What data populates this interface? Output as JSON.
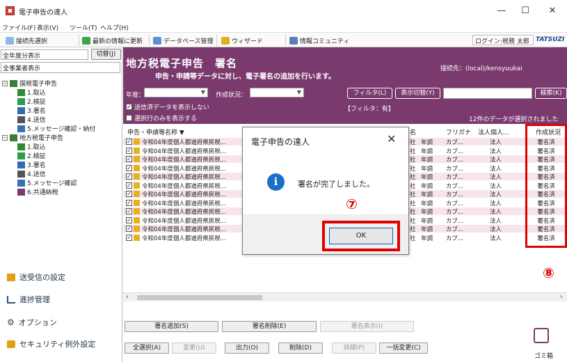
{
  "window": {
    "title": "電子申告の達人",
    "controls": {
      "minimize": "—",
      "maximize": "☐",
      "close": "✕"
    }
  },
  "menu": [
    "ファイル(F)",
    "表示(V)",
    "ツール(T)",
    "ヘルプ(H)"
  ],
  "toolbar": {
    "connection_select": "接続先選択",
    "update_latest": "最新の情報に更新",
    "db_manage": "データベース管理",
    "wizard": "ウィザード",
    "community": "情報コミュニティ",
    "login": "ログイン:税務 太郎",
    "brand": "TATSUZI"
  },
  "left": {
    "year_display": "全年度分表示",
    "switch_button": "切替(J)",
    "business_display": "全事業者表示",
    "tree": [
      {
        "label": "国税電子申告",
        "level": 0,
        "icon": "folder-icon",
        "color": "#3a7d3a"
      },
      {
        "label": "1.取込",
        "level": 1,
        "icon": "import-icon",
        "color": "#2d8a2d"
      },
      {
        "label": "2.検証",
        "level": 1,
        "icon": "check-icon",
        "color": "#2aa04a"
      },
      {
        "label": "3.署名",
        "level": 1,
        "icon": "sign-icon",
        "color": "#2f6cb0"
      },
      {
        "label": "4.送信",
        "level": 1,
        "icon": "send-icon",
        "color": "#555555"
      },
      {
        "label": "5.メッセージ確認・納付",
        "level": 1,
        "icon": "mail-icon",
        "color": "#3b6fb3"
      },
      {
        "label": "地方税電子申告",
        "level": 0,
        "icon": "folder-icon",
        "color": "#3a7d3a"
      },
      {
        "label": "1.取込",
        "level": 1,
        "icon": "import-icon",
        "color": "#2d8a2d"
      },
      {
        "label": "2.検証",
        "level": 1,
        "icon": "check-icon",
        "color": "#2aa04a"
      },
      {
        "label": "3.署名",
        "level": 1,
        "icon": "sign-icon",
        "color": "#2f6cb0"
      },
      {
        "label": "4.送信",
        "level": 1,
        "icon": "send-icon",
        "color": "#555555"
      },
      {
        "label": "5.メッセージ確認",
        "level": 1,
        "icon": "mail-icon",
        "color": "#3b6fb3"
      },
      {
        "label": "6.共通納税",
        "level": 1,
        "icon": "tax-icon",
        "color": "#7b3a6e"
      }
    ],
    "nav": [
      {
        "label": "送受信の設定",
        "icon": "transmit-settings-icon",
        "color": "#e0a010"
      },
      {
        "label": "進捗管理",
        "icon": "progress-icon",
        "color": "#2f4f7f"
      },
      {
        "label": "オプション",
        "icon": "gear-icon",
        "color": "#444444"
      },
      {
        "label": "セキュリティ例外設定",
        "icon": "lock-icon",
        "color": "#e0a010"
      }
    ]
  },
  "header": {
    "title": "地方税電子申告　署名",
    "subtitle": "申告・申請等データに対し、電子署名の追加を行います。",
    "connection": "接続先：(local)/kensyuukai",
    "year_label": "年度：",
    "status_label": "作成状況：",
    "filter_button": "フィルタ(L)",
    "display_switch_button": "表示切替(Y)",
    "search_button": "検索(K)",
    "hide_sent_label": "送信済データを表示しない",
    "show_selected_label": "選択行のみを表示する",
    "filter_status": "【フィルタ：有】",
    "selected_count": "12件のデータが選択されました"
  },
  "table": {
    "columns": [
      "申告・申請等名称 ▼",
      "名",
      "フリガナ",
      "法人個人...",
      "作成状況"
    ],
    "rows": [
      {
        "name": "令和04年度個人都道府県民税...",
        "col2": "社",
        "col3": "年調",
        "furigana": "カブ...",
        "type": "法人",
        "status": "署名済"
      },
      {
        "name": "令和04年度個人都道府県民税...",
        "col2": "社",
        "col3": "年調",
        "furigana": "カブ...",
        "type": "法人",
        "status": "署名済"
      },
      {
        "name": "令和04年度個人都道府県民税...",
        "col2": "社",
        "col3": "年調",
        "furigana": "カブ...",
        "type": "法人",
        "status": "署名済"
      },
      {
        "name": "令和04年度個人都道府県民税...",
        "col2": "社",
        "col3": "年調",
        "furigana": "カブ...",
        "type": "法人",
        "status": "署名済"
      },
      {
        "name": "令和04年度個人都道府県民税...",
        "col2": "社",
        "col3": "年調",
        "furigana": "カブ...",
        "type": "法人",
        "status": "署名済"
      },
      {
        "name": "令和04年度個人都道府県民税...",
        "col2": "社",
        "col3": "年調",
        "furigana": "カブ...",
        "type": "法人",
        "status": "署名済"
      },
      {
        "name": "令和04年度個人都道府県民税...",
        "col2": "社",
        "col3": "年調",
        "furigana": "カブ...",
        "type": "法人",
        "status": "署名済"
      },
      {
        "name": "令和04年度個人都道府県民税...",
        "col2": "社",
        "col3": "年調",
        "furigana": "カブ...",
        "type": "法人",
        "status": "署名済"
      },
      {
        "name": "令和04年度個人都道府県民税...",
        "col2": "社",
        "col3": "年調",
        "furigana": "カブ...",
        "type": "法人",
        "status": "署名済"
      },
      {
        "name": "令和04年度個人都道府県民税...",
        "col2": "社",
        "col3": "年調",
        "furigana": "カブ...",
        "type": "法人",
        "status": "署名済"
      },
      {
        "name": "令和04年度個人都道府県民税...",
        "col2": "社",
        "col3": "年調",
        "furigana": "カブ...",
        "type": "法人",
        "status": "署名済"
      },
      {
        "name": "令和04年度個人都道府県民税...",
        "col2": "社",
        "col3": "年調",
        "furigana": "カブ...",
        "type": "法人",
        "status": "署名済"
      }
    ]
  },
  "buttons": {
    "add_signature": "署名追加(S)",
    "delete_signature": "署名削除(E)",
    "show_signature": "署名表示(I)",
    "select_all": "全選択(A)",
    "change": "変更(U)",
    "output": "出力(O)",
    "delete": "削除(D)",
    "detail": "詳細(P)",
    "bulk_change": "一括変更(C)",
    "trash": "ゴミ箱"
  },
  "dialog": {
    "title": "電子申告の達人",
    "message": "署名が完了しました。",
    "ok": "OK",
    "info_glyph": "i"
  },
  "annotations": {
    "step7": "⑦",
    "step8": "⑧"
  },
  "colors": {
    "header_bg": "#7b3a6e",
    "highlight": "#e00000",
    "row_pink": "#f7e4ef"
  }
}
